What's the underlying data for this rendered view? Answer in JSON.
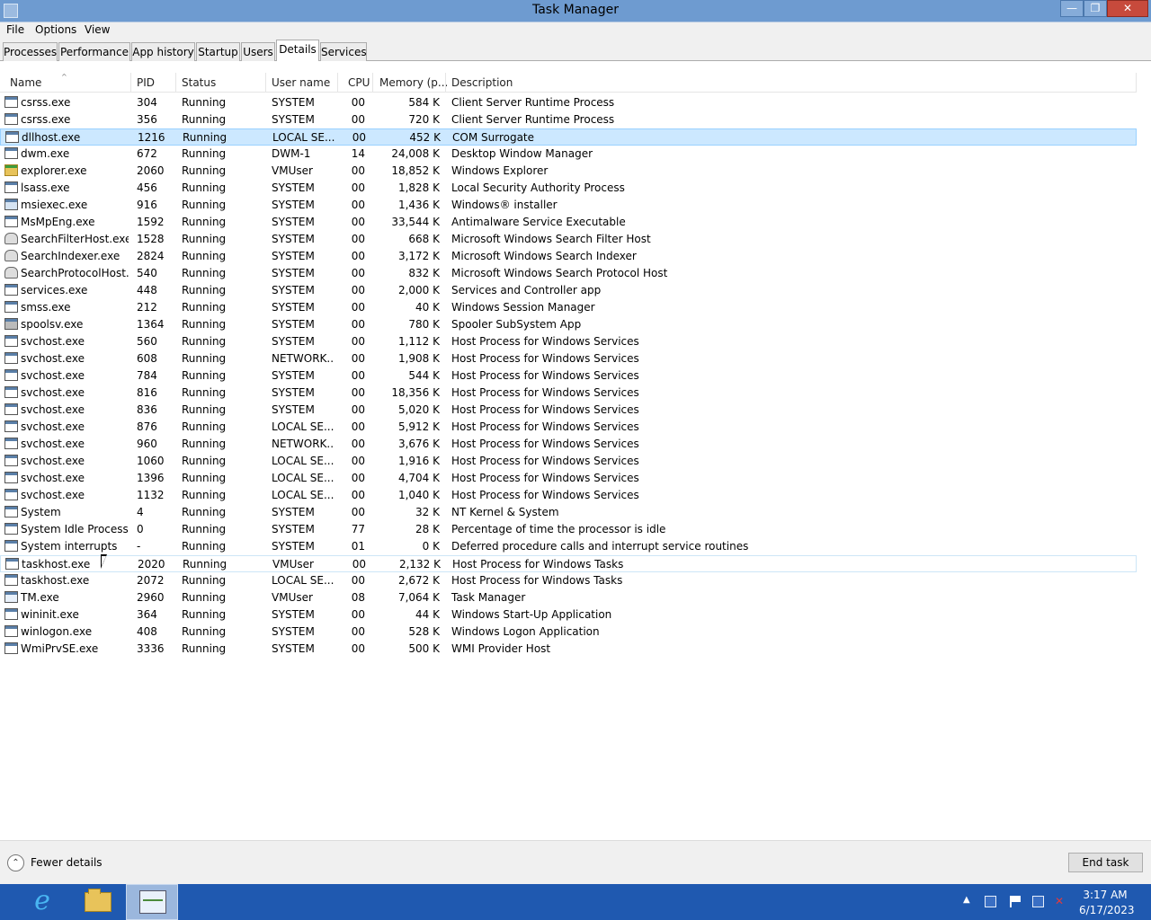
{
  "window": {
    "title": "Task Manager",
    "minimize_glyph": "—",
    "maximize_glyph": "❐",
    "close_glyph": "✕"
  },
  "menu": [
    "File",
    "Options",
    "View"
  ],
  "tabs": [
    {
      "label": "Processes",
      "active": false
    },
    {
      "label": "Performance",
      "active": false
    },
    {
      "label": "App history",
      "active": false
    },
    {
      "label": "Startup",
      "active": false
    },
    {
      "label": "Users",
      "active": false
    },
    {
      "label": "Details",
      "active": true
    },
    {
      "label": "Services",
      "active": false
    }
  ],
  "columns": {
    "name": "Name",
    "pid": "PID",
    "status": "Status",
    "user": "User name",
    "cpu": "CPU",
    "memory": "Memory (p...",
    "description": "Description",
    "sort_glyph": "^"
  },
  "rows": [
    {
      "icon": "app-window-icon",
      "name": "csrss.exe",
      "pid": "304",
      "status": "Running",
      "user": "SYSTEM",
      "cpu": "00",
      "memory": "584 K",
      "description": "Client Server Runtime Process"
    },
    {
      "icon": "app-window-icon",
      "name": "csrss.exe",
      "pid": "356",
      "status": "Running",
      "user": "SYSTEM",
      "cpu": "00",
      "memory": "720 K",
      "description": "Client Server Runtime Process"
    },
    {
      "icon": "app-window-icon",
      "name": "dllhost.exe",
      "pid": "1216",
      "status": "Running",
      "user": "LOCAL SE...",
      "cpu": "00",
      "memory": "452 K",
      "description": "COM Surrogate",
      "selected": true
    },
    {
      "icon": "app-window-icon",
      "name": "dwm.exe",
      "pid": "672",
      "status": "Running",
      "user": "DWM-1",
      "cpu": "14",
      "memory": "24,008 K",
      "description": "Desktop Window Manager"
    },
    {
      "icon": "folder-icon",
      "name": "explorer.exe",
      "pid": "2060",
      "status": "Running",
      "user": "VMUser",
      "cpu": "00",
      "memory": "18,852 K",
      "description": "Windows Explorer"
    },
    {
      "icon": "app-window-icon",
      "name": "lsass.exe",
      "pid": "456",
      "status": "Running",
      "user": "SYSTEM",
      "cpu": "00",
      "memory": "1,828 K",
      "description": "Local Security Authority Process"
    },
    {
      "icon": "installer-icon",
      "name": "msiexec.exe",
      "pid": "916",
      "status": "Running",
      "user": "SYSTEM",
      "cpu": "00",
      "memory": "1,436 K",
      "description": "Windows® installer"
    },
    {
      "icon": "app-window-icon",
      "name": "MsMpEng.exe",
      "pid": "1592",
      "status": "Running",
      "user": "SYSTEM",
      "cpu": "00",
      "memory": "33,544 K",
      "description": "Antimalware Service Executable"
    },
    {
      "icon": "person-icon",
      "name": "SearchFilterHost.exe",
      "pid": "1528",
      "status": "Running",
      "user": "SYSTEM",
      "cpu": "00",
      "memory": "668 K",
      "description": "Microsoft Windows Search Filter Host"
    },
    {
      "icon": "person-icon",
      "name": "SearchIndexer.exe",
      "pid": "2824",
      "status": "Running",
      "user": "SYSTEM",
      "cpu": "00",
      "memory": "3,172 K",
      "description": "Microsoft Windows Search Indexer"
    },
    {
      "icon": "person-icon",
      "name": "SearchProtocolHost....",
      "pid": "540",
      "status": "Running",
      "user": "SYSTEM",
      "cpu": "00",
      "memory": "832 K",
      "description": "Microsoft Windows Search Protocol Host"
    },
    {
      "icon": "app-window-icon",
      "name": "services.exe",
      "pid": "448",
      "status": "Running",
      "user": "SYSTEM",
      "cpu": "00",
      "memory": "2,000 K",
      "description": "Services and Controller app"
    },
    {
      "icon": "app-window-icon",
      "name": "smss.exe",
      "pid": "212",
      "status": "Running",
      "user": "SYSTEM",
      "cpu": "00",
      "memory": "40 K",
      "description": "Windows Session Manager"
    },
    {
      "icon": "printer-icon",
      "name": "spoolsv.exe",
      "pid": "1364",
      "status": "Running",
      "user": "SYSTEM",
      "cpu": "00",
      "memory": "780 K",
      "description": "Spooler SubSystem App"
    },
    {
      "icon": "app-window-icon",
      "name": "svchost.exe",
      "pid": "560",
      "status": "Running",
      "user": "SYSTEM",
      "cpu": "00",
      "memory": "1,112 K",
      "description": "Host Process for Windows Services"
    },
    {
      "icon": "app-window-icon",
      "name": "svchost.exe",
      "pid": "608",
      "status": "Running",
      "user": "NETWORK...",
      "cpu": "00",
      "memory": "1,908 K",
      "description": "Host Process for Windows Services"
    },
    {
      "icon": "app-window-icon",
      "name": "svchost.exe",
      "pid": "784",
      "status": "Running",
      "user": "SYSTEM",
      "cpu": "00",
      "memory": "544 K",
      "description": "Host Process for Windows Services"
    },
    {
      "icon": "app-window-icon",
      "name": "svchost.exe",
      "pid": "816",
      "status": "Running",
      "user": "SYSTEM",
      "cpu": "00",
      "memory": "18,356 K",
      "description": "Host Process for Windows Services"
    },
    {
      "icon": "app-window-icon",
      "name": "svchost.exe",
      "pid": "836",
      "status": "Running",
      "user": "SYSTEM",
      "cpu": "00",
      "memory": "5,020 K",
      "description": "Host Process for Windows Services"
    },
    {
      "icon": "app-window-icon",
      "name": "svchost.exe",
      "pid": "876",
      "status": "Running",
      "user": "LOCAL SE...",
      "cpu": "00",
      "memory": "5,912 K",
      "description": "Host Process for Windows Services"
    },
    {
      "icon": "app-window-icon",
      "name": "svchost.exe",
      "pid": "960",
      "status": "Running",
      "user": "NETWORK...",
      "cpu": "00",
      "memory": "3,676 K",
      "description": "Host Process for Windows Services"
    },
    {
      "icon": "app-window-icon",
      "name": "svchost.exe",
      "pid": "1060",
      "status": "Running",
      "user": "LOCAL SE...",
      "cpu": "00",
      "memory": "1,916 K",
      "description": "Host Process for Windows Services"
    },
    {
      "icon": "app-window-icon",
      "name": "svchost.exe",
      "pid": "1396",
      "status": "Running",
      "user": "LOCAL SE...",
      "cpu": "00",
      "memory": "4,704 K",
      "description": "Host Process for Windows Services"
    },
    {
      "icon": "app-window-icon",
      "name": "svchost.exe",
      "pid": "1132",
      "status": "Running",
      "user": "LOCAL SE...",
      "cpu": "00",
      "memory": "1,040 K",
      "description": "Host Process for Windows Services"
    },
    {
      "icon": "app-window-icon",
      "name": "System",
      "pid": "4",
      "status": "Running",
      "user": "SYSTEM",
      "cpu": "00",
      "memory": "32 K",
      "description": "NT Kernel & System"
    },
    {
      "icon": "app-window-icon",
      "name": "System Idle Process",
      "pid": "0",
      "status": "Running",
      "user": "SYSTEM",
      "cpu": "77",
      "memory": "28 K",
      "description": "Percentage of time the processor is idle"
    },
    {
      "icon": "app-window-icon",
      "name": "System interrupts",
      "pid": "-",
      "status": "Running",
      "user": "SYSTEM",
      "cpu": "01",
      "memory": "0 K",
      "description": "Deferred procedure calls and interrupt service routines"
    },
    {
      "icon": "app-window-icon",
      "name": "taskhost.exe",
      "pid": "2020",
      "status": "Running",
      "user": "VMUser",
      "cpu": "00",
      "memory": "2,132 K",
      "description": "Host Process for Windows Tasks",
      "hover": true
    },
    {
      "icon": "app-window-icon",
      "name": "taskhost.exe",
      "pid": "2072",
      "status": "Running",
      "user": "LOCAL SE...",
      "cpu": "00",
      "memory": "2,672 K",
      "description": "Host Process for Windows Tasks"
    },
    {
      "icon": "task-manager-icon",
      "name": "TM.exe",
      "pid": "2960",
      "status": "Running",
      "user": "VMUser",
      "cpu": "08",
      "memory": "7,064 K",
      "description": "Task Manager"
    },
    {
      "icon": "app-window-icon",
      "name": "wininit.exe",
      "pid": "364",
      "status": "Running",
      "user": "SYSTEM",
      "cpu": "00",
      "memory": "44 K",
      "description": "Windows Start-Up Application"
    },
    {
      "icon": "app-window-icon",
      "name": "winlogon.exe",
      "pid": "408",
      "status": "Running",
      "user": "SYSTEM",
      "cpu": "00",
      "memory": "528 K",
      "description": "Windows Logon Application"
    },
    {
      "icon": "app-window-icon",
      "name": "WmiPrvSE.exe",
      "pid": "3336",
      "status": "Running",
      "user": "SYSTEM",
      "cpu": "00",
      "memory": "500 K",
      "description": "WMI Provider Host"
    }
  ],
  "footer": {
    "fewer_details_label": "Fewer details",
    "fewer_details_glyph": "⌃",
    "end_task_label": "End task"
  },
  "taskbar": {
    "ie_glyph": "e",
    "tray_arrow_glyph": "▲",
    "volume_muted_glyph": "✕",
    "time": "3:17 AM",
    "date": "6/17/2023"
  },
  "colors": {
    "titlebar": "#6e9bd0",
    "selection": "#cce8ff",
    "taskbar": "#1f59b0"
  }
}
